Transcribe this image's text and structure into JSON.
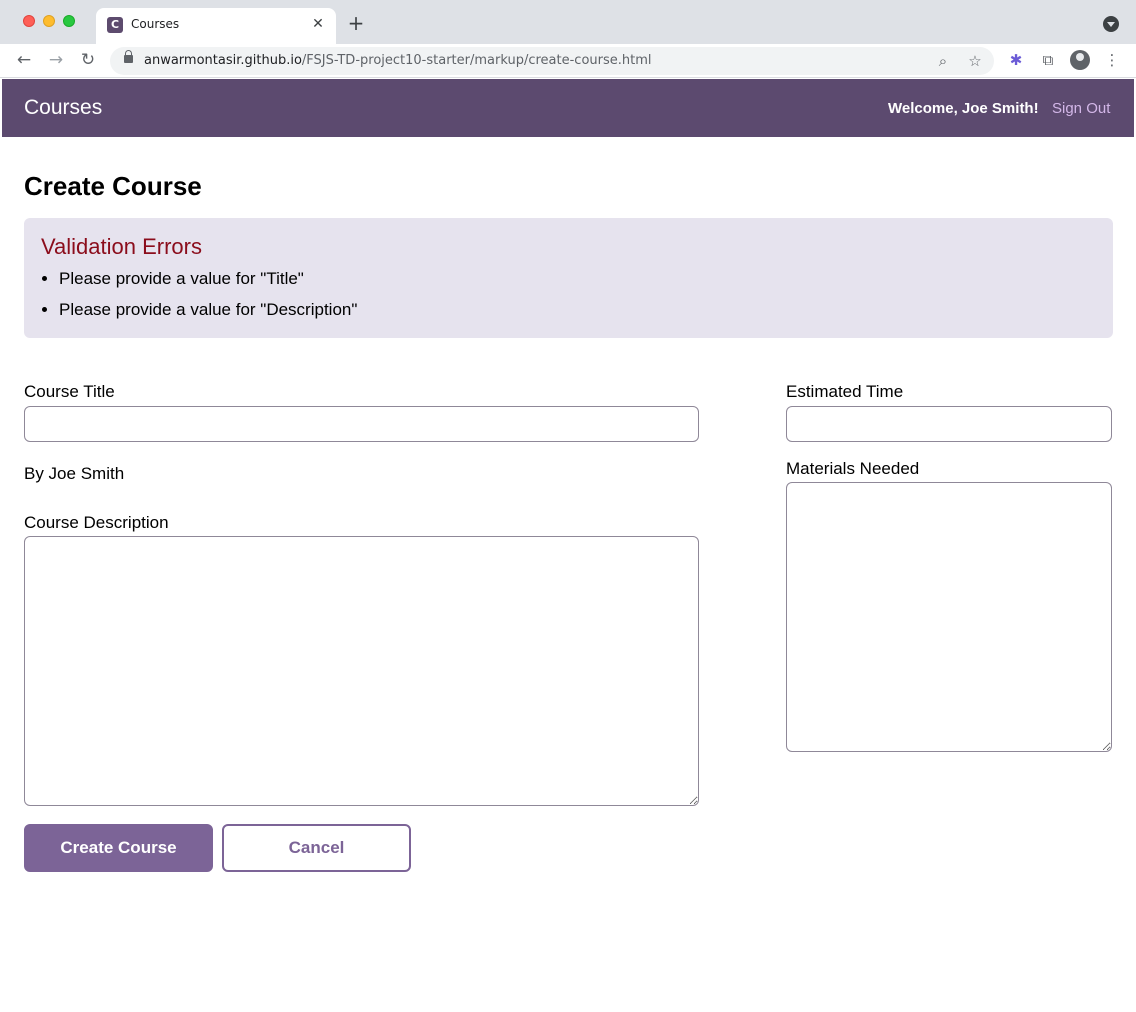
{
  "browser": {
    "tab_title": "Courses",
    "favicon_letter": "C",
    "tab_close": "✕",
    "new_tab": "+",
    "url_host": "anwarmontasir.github.io",
    "url_path": "/FSJS-TD-project10-starter/markup/create-course.html",
    "icons": {
      "back": "←",
      "forward": "→",
      "reload": "↻",
      "zoom": "⌕",
      "star": "☆",
      "extension": "✱",
      "puzzle": "⧉",
      "menu": "⋮"
    }
  },
  "header": {
    "brand": "Courses",
    "welcome": "Welcome, Joe Smith!",
    "sign_out": "Sign Out"
  },
  "main": {
    "title": "Create Course",
    "validation": {
      "title": "Validation Errors",
      "errors": [
        "Please provide a value for \"Title\"",
        "Please provide a value for \"Description\""
      ]
    },
    "form": {
      "course_title_label": "Course Title",
      "course_title_value": "",
      "author": "By Joe Smith",
      "description_label": "Course Description",
      "description_value": "",
      "estimated_time_label": "Estimated Time",
      "estimated_time_value": "",
      "materials_label": "Materials Needed",
      "materials_value": ""
    },
    "buttons": {
      "submit": "Create Course",
      "cancel": "Cancel"
    }
  },
  "colors": {
    "header_bg": "#5c4a6f",
    "accent": "#7c6497",
    "error_text": "#8b0d1c",
    "error_bg": "#e6e3ee"
  }
}
